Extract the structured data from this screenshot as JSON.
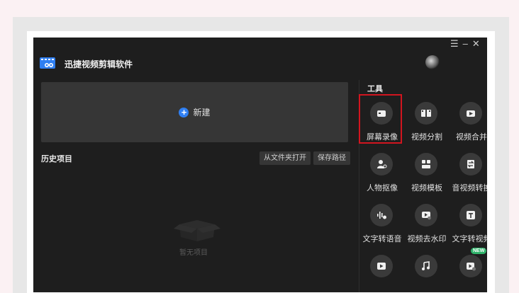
{
  "app": {
    "title": "迅捷视频剪辑软件",
    "accent_color": "#2f7ff2",
    "highlight_color": "#d2151f",
    "window_controls": [
      "☰",
      "–",
      "✕"
    ]
  },
  "main": {
    "new_button_label": "新建",
    "history_title": "历史项目",
    "open_from_folder_label": "从文件夹打开",
    "save_path_label": "保存路径",
    "empty_label": "暂无项目"
  },
  "tools": {
    "title": "工具",
    "new_badge": "NEW",
    "items": [
      {
        "label": "屏幕录像",
        "icon": "screen-record-icon"
      },
      {
        "label": "视频分割",
        "icon": "video-split-icon"
      },
      {
        "label": "视频合并",
        "icon": "video-merge-icon"
      },
      {
        "label": "人物抠像",
        "icon": "person-cutout-icon"
      },
      {
        "label": "视频模板",
        "icon": "video-template-icon"
      },
      {
        "label": "音视频转换",
        "icon": "av-convert-icon"
      },
      {
        "label": "文字转语音",
        "icon": "text-to-speech-icon"
      },
      {
        "label": "视频去水印",
        "icon": "remove-watermark-icon"
      },
      {
        "label": "文字转视频",
        "icon": "text-to-video-icon"
      },
      {
        "label": "",
        "icon": "video-play-icon"
      },
      {
        "label": "",
        "icon": "music-icon"
      },
      {
        "label": "",
        "icon": "video-add-icon"
      }
    ]
  }
}
